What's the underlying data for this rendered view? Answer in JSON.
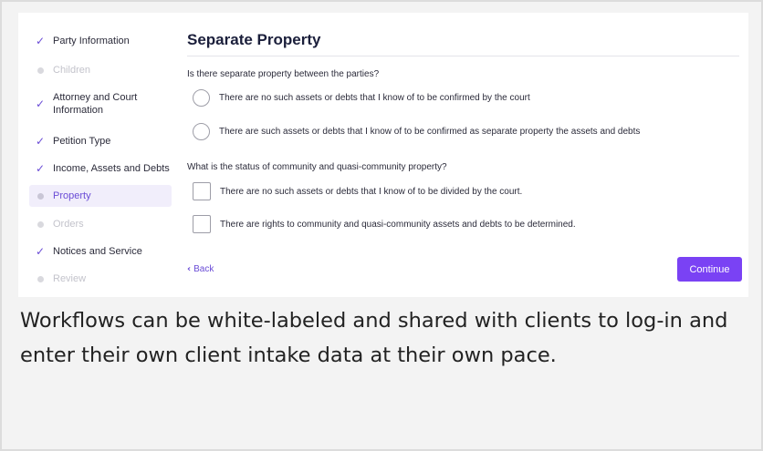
{
  "sidebar": {
    "steps": [
      {
        "label": "Party Information",
        "state": "done"
      },
      {
        "label": "Children",
        "state": "disabled"
      },
      {
        "label": "Attorney and Court Information",
        "state": "done"
      },
      {
        "label": "Petition Type",
        "state": "done"
      },
      {
        "label": "Income, Assets and Debts",
        "state": "done"
      },
      {
        "label": "Property",
        "state": "active"
      },
      {
        "label": "Orders",
        "state": "disabled"
      },
      {
        "label": "Notices and Service",
        "state": "done"
      },
      {
        "label": "Review",
        "state": "disabled"
      }
    ]
  },
  "main": {
    "title": "Separate Property",
    "question1": {
      "text": "Is there separate property between the parties?",
      "options": [
        "There are no such assets or debts that I know of to be confirmed by the court",
        "There are such assets or debts that I know of to be confirmed as separate property the assets and debts"
      ]
    },
    "question2": {
      "text": "What is the status of community and quasi-community property?",
      "options": [
        "There are no such assets or debts that I know of to be divided by the court.",
        "There are rights to community and quasi-community assets and debts to be determined."
      ]
    },
    "back_label": "Back",
    "continue_label": "Continue"
  },
  "caption": "Workflows can be white-labeled and shared with clients to log-in and enter their own client intake data at their own pace.",
  "colors": {
    "accent": "#7a42f4",
    "check": "#6a4cd6"
  }
}
